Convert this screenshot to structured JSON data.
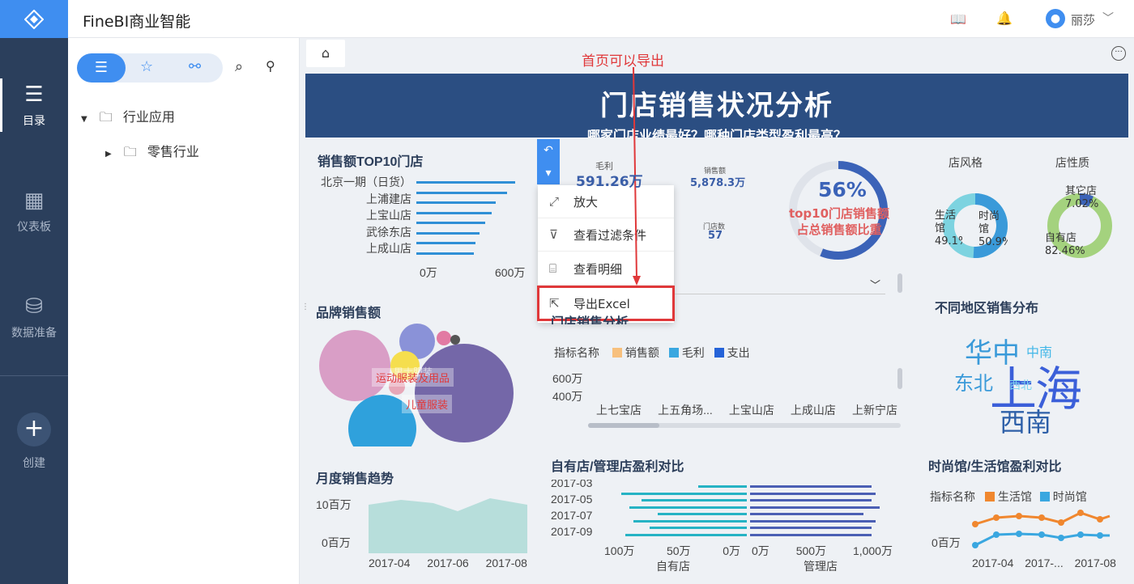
{
  "app": {
    "title": "FineBI商业智能",
    "user": "丽莎"
  },
  "nav": {
    "items": [
      {
        "label": "目录"
      },
      {
        "label": "仪表板"
      },
      {
        "label": "数据准备"
      },
      {
        "label": "创建"
      }
    ]
  },
  "tree": {
    "root": "行业应用",
    "child": "零售行业"
  },
  "annotation": "首页可以导出",
  "banner": {
    "title": "门店销售状况分析",
    "subtitle": "哪家门店业绩最好？哪种门店类型盈利最高？"
  },
  "menu": {
    "items": [
      "放大",
      "查看过滤条件",
      "查看明细",
      "导出Excel"
    ]
  },
  "top10": {
    "title": "销售额TOP10门店",
    "stores": [
      "北京一期（日货）",
      "上浦建店",
      "上宝山店",
      "武徐东店",
      "上成山店"
    ],
    "axis": [
      "0万",
      "600万"
    ],
    "values": [
      100,
      92,
      80,
      76,
      70,
      64,
      60,
      58
    ]
  },
  "kpis": {
    "gross_label": "毛利",
    "gross_value": "591.26万",
    "sales_label": "销售额",
    "sales_value": "5,878.3万",
    "stores_label": "门店数",
    "stores_value": "57"
  },
  "gauge": {
    "pct": "56%",
    "label1": "top10门店销售额",
    "label2": "占总销售额比重",
    "value": 0.56
  },
  "style_chart": {
    "title": "店风格",
    "l1": "生活馆",
    "p1": "49.1%",
    "l2": "时尚馆",
    "p2": "50.9%"
  },
  "nature_chart": {
    "title": "店性质",
    "l1": "其它店",
    "p1": "7.02%",
    "l2": "自有店",
    "p2": "82.46%"
  },
  "brand": {
    "title": "品牌销售额",
    "label1": "运动服装及用品",
    "label2": "儿童服装",
    "label3": "男士服装"
  },
  "store_sales": {
    "title": "门店销售分析",
    "legend_title": "指标名称",
    "legend": [
      "销售额",
      "毛利",
      "支出"
    ],
    "yticks": [
      "600万",
      "400万"
    ],
    "categories": [
      "上七宝店",
      "上五角场...",
      "上宝山店",
      "上成山店",
      "上新宁店"
    ],
    "colors": [
      "#f7c07d",
      "#3aa7e0",
      "#2563d8"
    ]
  },
  "region": {
    "title": "不同地区销售分布",
    "words": [
      "华中",
      "中南",
      "东北",
      "上海",
      "西北",
      "西南"
    ]
  },
  "monthly": {
    "title": "月度销售趋势",
    "yticks": [
      "10百万",
      "0百万"
    ],
    "xticks": [
      "2017-04",
      "2017-06",
      "2017-08"
    ]
  },
  "own_vs_mgmt": {
    "title": "自有店/管理店盈利对比",
    "months": [
      "2017-03",
      "2017-05",
      "2017-07",
      "2017-09"
    ],
    "left_ticks": [
      "100万",
      "50万",
      "0万"
    ],
    "right_ticks": [
      "0万",
      "500万",
      "1,000万"
    ],
    "left_label": "自有店",
    "right_label": "管理店"
  },
  "fashion_life": {
    "title": "时尚馆/生活馆盈利对比",
    "legend_title": "指标名称",
    "legend": [
      "生活馆",
      "时尚馆"
    ],
    "ytick": "0百万",
    "xticks": [
      "2017-04",
      "2017-...",
      "2017-08"
    ]
  }
}
